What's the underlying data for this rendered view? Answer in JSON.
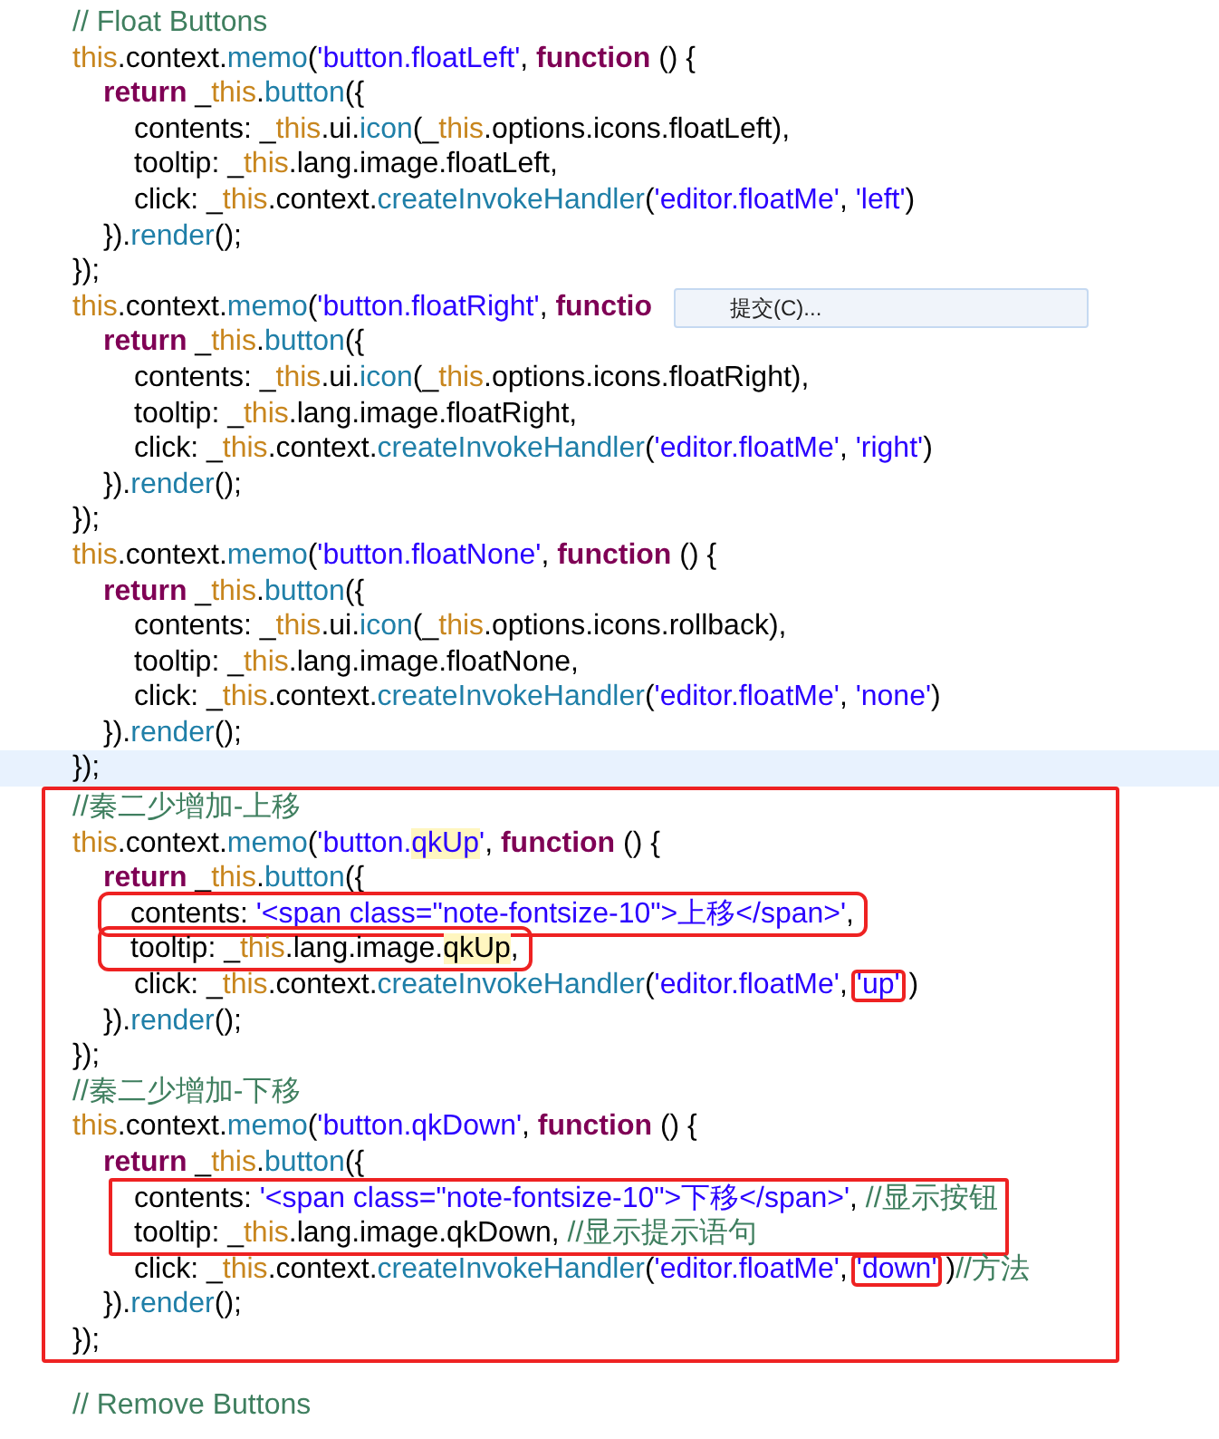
{
  "sections": [
    {
      "annotated": false,
      "lines": [
        {
          "kind": "top",
          "current": false,
          "tokens": [
            {
              "kind": "cm",
              "t": "// Float Buttons"
            }
          ]
        },
        {
          "kind": "top",
          "current": false,
          "tokens": [
            {
              "kind": "this",
              "t": "this"
            },
            {
              "kind": "plain",
              "t": ".context."
            },
            {
              "kind": "fn",
              "t": "memo"
            },
            {
              "kind": "plain",
              "t": "("
            },
            {
              "kind": "str",
              "t": "'button.floatLeft'"
            },
            {
              "kind": "plain",
              "t": ", "
            },
            {
              "kind": "kw",
              "t": "function"
            },
            {
              "kind": "plain",
              "t": " () {"
            }
          ]
        },
        {
          "kind": "body",
          "current": false,
          "tokens": [
            {
              "kind": "kw",
              "t": "return"
            },
            {
              "kind": "plain",
              "t": " _"
            },
            {
              "kind": "this",
              "t": "this"
            },
            {
              "kind": "plain",
              "t": "."
            },
            {
              "kind": "fn",
              "t": "button"
            },
            {
              "kind": "plain",
              "t": "({"
            }
          ]
        },
        {
          "kind": "inner",
          "current": false,
          "tokens": [
            {
              "kind": "plain",
              "t": "contents: _"
            },
            {
              "kind": "this",
              "t": "this"
            },
            {
              "kind": "plain",
              "t": ".ui."
            },
            {
              "kind": "fn",
              "t": "icon"
            },
            {
              "kind": "plain",
              "t": "(_"
            },
            {
              "kind": "this",
              "t": "this"
            },
            {
              "kind": "plain",
              "t": ".options.icons.floatLeft),"
            }
          ]
        },
        {
          "kind": "inner",
          "current": false,
          "tokens": [
            {
              "kind": "plain",
              "t": "tooltip: _"
            },
            {
              "kind": "this",
              "t": "this"
            },
            {
              "kind": "plain",
              "t": ".lang.image.floatLeft,"
            }
          ]
        },
        {
          "kind": "inner",
          "current": false,
          "tokens": [
            {
              "kind": "plain",
              "t": "click: _"
            },
            {
              "kind": "this",
              "t": "this"
            },
            {
              "kind": "plain",
              "t": ".context."
            },
            {
              "kind": "fn",
              "t": "createInvokeHandler"
            },
            {
              "kind": "plain",
              "t": "("
            },
            {
              "kind": "str",
              "t": "'editor.floatMe'"
            },
            {
              "kind": "plain",
              "t": ", "
            },
            {
              "kind": "str",
              "t": "'left'"
            },
            {
              "kind": "plain",
              "t": ")"
            }
          ]
        },
        {
          "kind": "body",
          "current": false,
          "tokens": [
            {
              "kind": "plain",
              "t": "})."
            },
            {
              "kind": "fn",
              "t": "render"
            },
            {
              "kind": "plain",
              "t": "();"
            }
          ]
        },
        {
          "kind": "top",
          "current": false,
          "tokens": [
            {
              "kind": "plain",
              "t": "});"
            }
          ]
        },
        {
          "kind": "top",
          "current": false,
          "popup": {
            "label": "提交(C)..."
          },
          "tokens": [
            {
              "kind": "this",
              "t": "this"
            },
            {
              "kind": "plain",
              "t": ".context."
            },
            {
              "kind": "fn",
              "t": "memo"
            },
            {
              "kind": "plain",
              "t": "("
            },
            {
              "kind": "str",
              "t": "'button.floatRight'"
            },
            {
              "kind": "plain",
              "t": ", "
            },
            {
              "kind": "kw",
              "t": "functio"
            }
          ]
        },
        {
          "kind": "body",
          "current": false,
          "tokens": [
            {
              "kind": "kw",
              "t": "return"
            },
            {
              "kind": "plain",
              "t": " _"
            },
            {
              "kind": "this",
              "t": "this"
            },
            {
              "kind": "plain",
              "t": "."
            },
            {
              "kind": "fn",
              "t": "button"
            },
            {
              "kind": "plain",
              "t": "({"
            }
          ]
        },
        {
          "kind": "inner",
          "current": false,
          "tokens": [
            {
              "kind": "plain",
              "t": "contents: _"
            },
            {
              "kind": "this",
              "t": "this"
            },
            {
              "kind": "plain",
              "t": ".ui."
            },
            {
              "kind": "fn",
              "t": "icon"
            },
            {
              "kind": "plain",
              "t": "(_"
            },
            {
              "kind": "this",
              "t": "this"
            },
            {
              "kind": "plain",
              "t": ".options.icons.floatRight),"
            }
          ]
        },
        {
          "kind": "inner",
          "current": false,
          "tokens": [
            {
              "kind": "plain",
              "t": "tooltip: _"
            },
            {
              "kind": "this",
              "t": "this"
            },
            {
              "kind": "plain",
              "t": ".lang.image.floatRight,"
            }
          ]
        },
        {
          "kind": "inner",
          "current": false,
          "tokens": [
            {
              "kind": "plain",
              "t": "click: _"
            },
            {
              "kind": "this",
              "t": "this"
            },
            {
              "kind": "plain",
              "t": ".context."
            },
            {
              "kind": "fn",
              "t": "createInvokeHandler"
            },
            {
              "kind": "plain",
              "t": "("
            },
            {
              "kind": "str",
              "t": "'editor.floatMe'"
            },
            {
              "kind": "plain",
              "t": ", "
            },
            {
              "kind": "str",
              "t": "'right'"
            },
            {
              "kind": "plain",
              "t": ")"
            }
          ]
        },
        {
          "kind": "body",
          "current": false,
          "tokens": [
            {
              "kind": "plain",
              "t": "})."
            },
            {
              "kind": "fn",
              "t": "render"
            },
            {
              "kind": "plain",
              "t": "();"
            }
          ]
        },
        {
          "kind": "top",
          "current": false,
          "tokens": [
            {
              "kind": "plain",
              "t": "});"
            }
          ]
        },
        {
          "kind": "top",
          "current": false,
          "tokens": [
            {
              "kind": "this",
              "t": "this"
            },
            {
              "kind": "plain",
              "t": ".context."
            },
            {
              "kind": "fn",
              "t": "memo"
            },
            {
              "kind": "plain",
              "t": "("
            },
            {
              "kind": "str",
              "t": "'button.floatNone'"
            },
            {
              "kind": "plain",
              "t": ", "
            },
            {
              "kind": "kw",
              "t": "function"
            },
            {
              "kind": "plain",
              "t": " () {"
            }
          ]
        },
        {
          "kind": "body",
          "current": false,
          "tokens": [
            {
              "kind": "kw",
              "t": "return"
            },
            {
              "kind": "plain",
              "t": " _"
            },
            {
              "kind": "this",
              "t": "this"
            },
            {
              "kind": "plain",
              "t": "."
            },
            {
              "kind": "fn",
              "t": "button"
            },
            {
              "kind": "plain",
              "t": "({"
            }
          ]
        },
        {
          "kind": "inner",
          "current": false,
          "tokens": [
            {
              "kind": "plain",
              "t": "contents: _"
            },
            {
              "kind": "this",
              "t": "this"
            },
            {
              "kind": "plain",
              "t": ".ui."
            },
            {
              "kind": "fn",
              "t": "icon"
            },
            {
              "kind": "plain",
              "t": "(_"
            },
            {
              "kind": "this",
              "t": "this"
            },
            {
              "kind": "plain",
              "t": ".options.icons.rollback),"
            }
          ]
        },
        {
          "kind": "inner",
          "current": false,
          "tokens": [
            {
              "kind": "plain",
              "t": "tooltip: _"
            },
            {
              "kind": "this",
              "t": "this"
            },
            {
              "kind": "plain",
              "t": ".lang.image.floatNone,"
            }
          ]
        },
        {
          "kind": "inner",
          "current": false,
          "tokens": [
            {
              "kind": "plain",
              "t": "click: _"
            },
            {
              "kind": "this",
              "t": "this"
            },
            {
              "kind": "plain",
              "t": ".context."
            },
            {
              "kind": "fn",
              "t": "createInvokeHandler"
            },
            {
              "kind": "plain",
              "t": "("
            },
            {
              "kind": "str",
              "t": "'editor.floatMe'"
            },
            {
              "kind": "plain",
              "t": ", "
            },
            {
              "kind": "str",
              "t": "'none'"
            },
            {
              "kind": "plain",
              "t": ")"
            }
          ]
        },
        {
          "kind": "body",
          "current": false,
          "tokens": [
            {
              "kind": "plain",
              "t": "})."
            },
            {
              "kind": "fn",
              "t": "render"
            },
            {
              "kind": "plain",
              "t": "();"
            }
          ]
        },
        {
          "kind": "top",
          "current": true,
          "tokens": [
            {
              "kind": "plain",
              "t": "});"
            }
          ]
        }
      ]
    },
    {
      "annotated": true,
      "lines": [
        {
          "kind": "top",
          "current": false,
          "tokens": [
            {
              "kind": "cm",
              "t": "//秦二少增加-上移"
            }
          ]
        },
        {
          "kind": "top",
          "current": false,
          "tokens": [
            {
              "kind": "this",
              "t": "this"
            },
            {
              "kind": "plain",
              "t": ".context."
            },
            {
              "kind": "fn",
              "t": "memo"
            },
            {
              "kind": "plain",
              "t": "("
            },
            {
              "kind": "str",
              "t": "'button."
            },
            {
              "kind": "str",
              "t": "qkUp",
              "mark": true
            },
            {
              "kind": "str",
              "t": "'"
            },
            {
              "kind": "plain",
              "t": ", "
            },
            {
              "kind": "kw",
              "t": "function"
            },
            {
              "kind": "plain",
              "t": " () {"
            }
          ]
        },
        {
          "kind": "body",
          "current": false,
          "tokens": [
            {
              "kind": "kw",
              "t": "return"
            },
            {
              "kind": "plain",
              "t": " _"
            },
            {
              "kind": "this",
              "t": "this"
            },
            {
              "kind": "plain",
              "t": "."
            },
            {
              "kind": "fn",
              "t": "button"
            },
            {
              "kind": "plain",
              "t": "({"
            }
          ]
        },
        {
          "kind": "inner",
          "current": false,
          "boxed": true,
          "tokens": [
            {
              "kind": "plain",
              "t": "contents: "
            },
            {
              "kind": "str",
              "t": "'<span class=\"note-fontsize-10\">上移</span>'"
            },
            {
              "kind": "plain",
              "t": ","
            }
          ]
        },
        {
          "kind": "inner",
          "current": false,
          "boxed": true,
          "tokens": [
            {
              "kind": "plain",
              "t": "tooltip: _"
            },
            {
              "kind": "this",
              "t": "this"
            },
            {
              "kind": "plain",
              "t": ".lang.image."
            },
            {
              "kind": "plain",
              "t": "qkUp",
              "mark": true
            },
            {
              "kind": "plain",
              "t": ","
            }
          ]
        },
        {
          "kind": "inner",
          "current": false,
          "tokens": [
            {
              "kind": "plain",
              "t": "click: _"
            },
            {
              "kind": "this",
              "t": "this"
            },
            {
              "kind": "plain",
              "t": ".context."
            },
            {
              "kind": "fn",
              "t": "createInvokeHandler"
            },
            {
              "kind": "plain",
              "t": "("
            },
            {
              "kind": "str",
              "t": "'editor.floatMe'"
            },
            {
              "kind": "plain",
              "t": ","
            },
            {
              "kind": "str",
              "t": "'up'",
              "box": true
            },
            {
              "kind": "plain",
              "t": ")"
            }
          ]
        },
        {
          "kind": "body",
          "current": false,
          "tokens": [
            {
              "kind": "plain",
              "t": "})."
            },
            {
              "kind": "fn",
              "t": "render"
            },
            {
              "kind": "plain",
              "t": "();"
            }
          ]
        },
        {
          "kind": "top",
          "current": false,
          "tokens": [
            {
              "kind": "plain",
              "t": "});"
            }
          ]
        },
        {
          "kind": "top",
          "current": false,
          "tokens": [
            {
              "kind": "cm",
              "t": "//秦二少增加-下移"
            }
          ]
        },
        {
          "kind": "top",
          "current": false,
          "tokens": [
            {
              "kind": "this",
              "t": "this"
            },
            {
              "kind": "plain",
              "t": ".context."
            },
            {
              "kind": "fn",
              "t": "memo"
            },
            {
              "kind": "plain",
              "t": "("
            },
            {
              "kind": "str",
              "t": "'button.qkDown'"
            },
            {
              "kind": "plain",
              "t": ", "
            },
            {
              "kind": "kw",
              "t": "function"
            },
            {
              "kind": "plain",
              "t": " () {"
            }
          ]
        },
        {
          "kind": "body",
          "current": false,
          "tokens": [
            {
              "kind": "kw",
              "t": "return"
            },
            {
              "kind": "plain",
              "t": " _"
            },
            {
              "kind": "this",
              "t": "this"
            },
            {
              "kind": "plain",
              "t": "."
            },
            {
              "kind": "fn",
              "t": "button"
            },
            {
              "kind": "plain",
              "t": "({"
            }
          ]
        },
        {
          "kind": "box_group",
          "lines": [
            {
              "kind": "grouped",
              "current": false,
              "tokens": [
                {
                  "kind": "plain",
                  "t": "contents: "
                },
                {
                  "kind": "str",
                  "t": "'<span class=\"note-fontsize-10\">下移</span>'"
                },
                {
                  "kind": "plain",
                  "t": ", "
                },
                {
                  "kind": "cm",
                  "t": "//显示按钮"
                }
              ]
            },
            {
              "kind": "grouped",
              "current": false,
              "tokens": [
                {
                  "kind": "plain",
                  "t": "tooltip: _"
                },
                {
                  "kind": "this",
                  "t": "this"
                },
                {
                  "kind": "plain",
                  "t": ".lang.image.qkDown, "
                },
                {
                  "kind": "cm",
                  "t": "//显示提示语句"
                }
              ]
            }
          ]
        },
        {
          "kind": "inner",
          "current": false,
          "tokens": [
            {
              "kind": "plain",
              "t": "click: _"
            },
            {
              "kind": "this",
              "t": "this"
            },
            {
              "kind": "plain",
              "t": ".context."
            },
            {
              "kind": "fn",
              "t": "createInvokeHandler"
            },
            {
              "kind": "plain",
              "t": "("
            },
            {
              "kind": "str",
              "t": "'editor.floatMe'"
            },
            {
              "kind": "plain",
              "t": ","
            },
            {
              "kind": "str",
              "t": "'down'",
              "box": true
            },
            {
              "kind": "plain",
              "t": ")"
            },
            {
              "kind": "cm",
              "t": "//方法"
            }
          ]
        },
        {
          "kind": "body",
          "current": false,
          "tokens": [
            {
              "kind": "plain",
              "t": "})."
            },
            {
              "kind": "fn",
              "t": "render"
            },
            {
              "kind": "plain",
              "t": "();"
            }
          ]
        },
        {
          "kind": "top",
          "current": false,
          "tokens": [
            {
              "kind": "plain",
              "t": "});"
            }
          ]
        }
      ]
    },
    {
      "annotated": false,
      "lines": [
        {
          "kind": "top",
          "current": false,
          "tokens": [
            {
              "kind": "cm",
              "t": "// Remove Buttons"
            }
          ]
        }
      ]
    }
  ]
}
